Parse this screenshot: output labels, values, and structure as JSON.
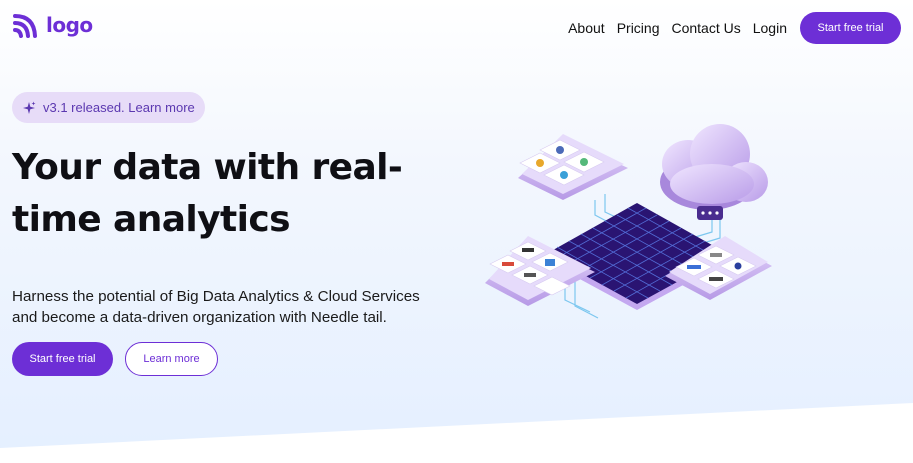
{
  "nav": {
    "logo_text": "logo",
    "links": [
      "About",
      "Pricing",
      "Contact Us",
      "Login"
    ],
    "cta_label": "Start free trial"
  },
  "hero": {
    "badge_text": "v3.1 released. Learn more",
    "headline_line1": "Your data with real-",
    "headline_line2": "time analytics",
    "subtext_line1": "Harness the potential of Big Data Analytics & Cloud Services",
    "subtext_line2": "and become a data-driven organization with Needle tail.",
    "primary_cta": "Start free trial",
    "secondary_cta": "Learn more"
  },
  "colors": {
    "brand": "#6d2fd6",
    "badge_bg": "#e7dcf8",
    "badge_text": "#5b38b0"
  },
  "icons": {
    "logo": "wifi-arcs-logo-icon",
    "badge": "sparkle-icon",
    "illustration": "cloud-data-platform-illustration"
  }
}
